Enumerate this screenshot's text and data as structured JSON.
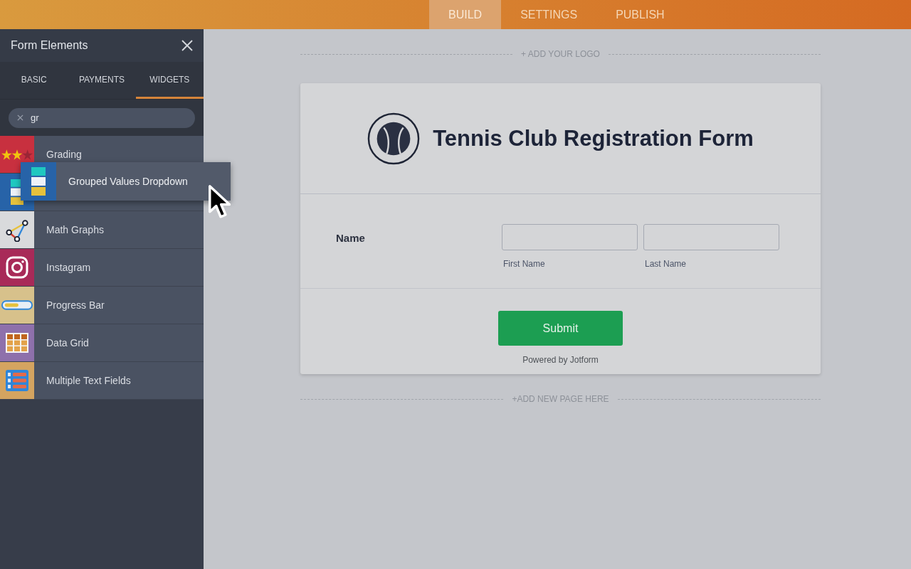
{
  "top_tabs": [
    {
      "label": "BUILD",
      "selected": true
    },
    {
      "label": "SETTINGS",
      "selected": false
    },
    {
      "label": "PUBLISH",
      "selected": false
    }
  ],
  "panel": {
    "title": "Form Elements",
    "tabs": [
      {
        "label": "BASIC",
        "selected": false
      },
      {
        "label": "PAYMENTS",
        "selected": false
      },
      {
        "label": "WIDGETS",
        "selected": true
      }
    ],
    "search": {
      "value": "gr"
    },
    "items": [
      {
        "kind": "stars",
        "label": "Grading"
      },
      {
        "kind": "stack"
      },
      {
        "kind": "graph",
        "label": "Math Graphs"
      },
      {
        "kind": "camera",
        "label": "Instagram"
      },
      {
        "kind": "progress",
        "label": "Progress Bar"
      },
      {
        "kind": "grid",
        "label": "Data Grid"
      },
      {
        "kind": "fields",
        "label": "Multiple Text Fields"
      }
    ],
    "dragging": {
      "kind": "stack",
      "label": "Grouped Values Dropdown"
    }
  },
  "canvas": {
    "add_logo": "+ ADD YOUR LOGO",
    "form_title": "Tennis Club Registration Form",
    "field": {
      "label": "Name",
      "inputs": [
        {
          "sublabel": "First Name"
        },
        {
          "sublabel": "Last Name"
        }
      ]
    },
    "submit": "Submit",
    "powered_by": "Powered by Jotform",
    "add_page": "+ADD NEW PAGE HERE"
  }
}
